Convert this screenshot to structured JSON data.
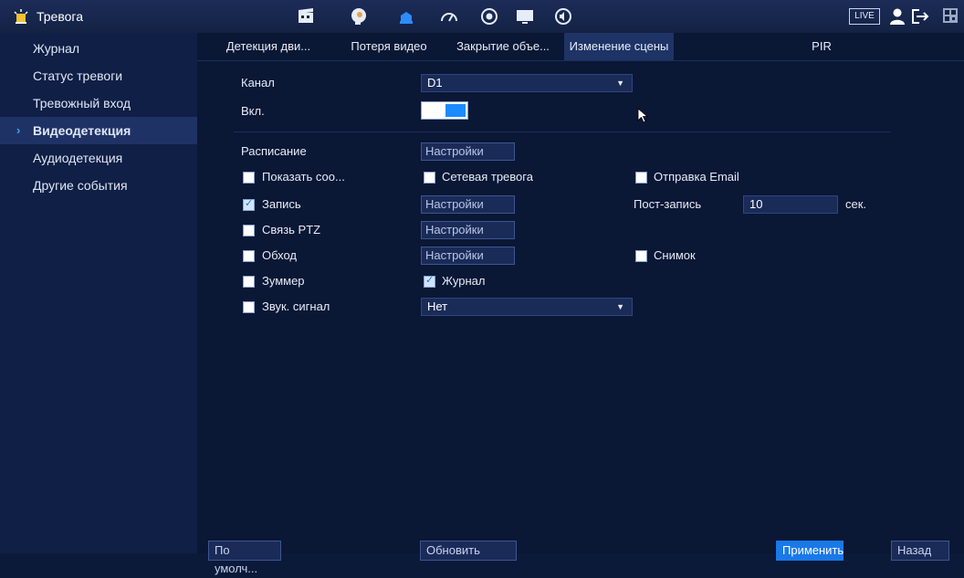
{
  "header": {
    "title": "Тревога",
    "live_label": "LIVE",
    "icons": [
      "film-icon",
      "face-icon",
      "shield-icon",
      "speed-icon",
      "record-icon",
      "monitor-icon",
      "audio-icon"
    ]
  },
  "sidebar": {
    "items": [
      {
        "label": "Журнал",
        "active": false
      },
      {
        "label": "Статус тревоги",
        "active": false
      },
      {
        "label": "Тревожный вход",
        "active": false
      },
      {
        "label": "Видеодетекция",
        "active": true
      },
      {
        "label": "Аудиодетекция",
        "active": false
      },
      {
        "label": "Другие события",
        "active": false
      }
    ]
  },
  "tabs": [
    {
      "label": "Детекция дви...",
      "active": false
    },
    {
      "label": "Потеря видео",
      "active": false
    },
    {
      "label": "Закрытие объе...",
      "active": false
    },
    {
      "label": "Изменение сцены",
      "active": true
    },
    {
      "label": "PIR",
      "active": false
    }
  ],
  "form": {
    "channel_label": "Канал",
    "channel_value": "D1",
    "enable_label": "Вкл.",
    "schedule_label": "Расписание",
    "settings_label": "Настройки",
    "show_msg_label": "Показать соо...",
    "network_alarm_label": "Сетевая тревога",
    "send_email_label": "Отправка Email",
    "record_label": "Запись",
    "post_record_label": "Пост-запись",
    "post_record_value": "10",
    "post_record_unit": "сек.",
    "ptz_label": "Связь PTZ",
    "tour_label": "Обход",
    "snapshot_label": "Снимок",
    "buzzer_label": "Зуммер",
    "log_label": "Журнал",
    "sound_label": "Звук. сигнал",
    "sound_value": "Нет"
  },
  "footer": {
    "default_label": "По умолч...",
    "refresh_label": "Обновить",
    "apply_label": "Применить",
    "back_label": "Назад"
  },
  "colors": {
    "background": "#0a1735",
    "accent": "#1a78e8",
    "toggle": "#1a8cff"
  }
}
